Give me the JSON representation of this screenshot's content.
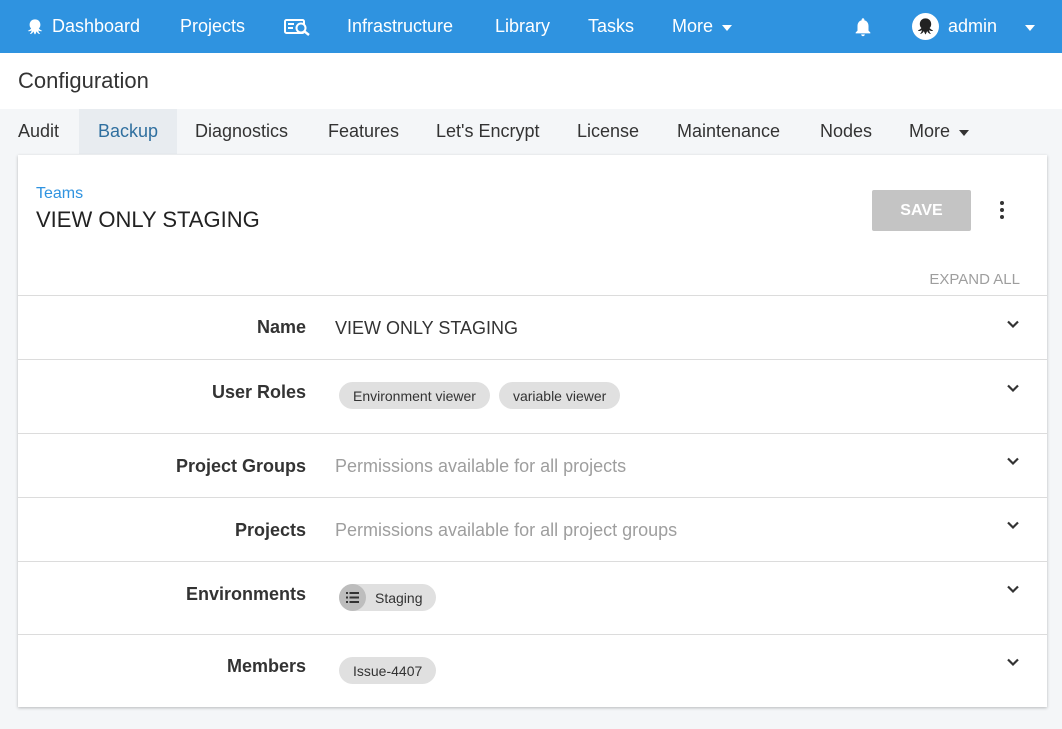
{
  "topbar": {
    "items": [
      {
        "label": "Dashboard"
      },
      {
        "label": "Projects"
      },
      {
        "label": "Infrastructure"
      },
      {
        "label": "Library"
      },
      {
        "label": "Tasks"
      },
      {
        "label": "More"
      }
    ],
    "user": "admin",
    "color": "#2f93e0",
    "icons": [
      "octopus-icon",
      "search-report-icon",
      "bell-icon",
      "avatar-icon",
      "chevron-down-icon"
    ]
  },
  "page": {
    "title": "Configuration"
  },
  "tabs": {
    "items": [
      {
        "label": "Audit"
      },
      {
        "label": "Backup"
      },
      {
        "label": "Diagnostics"
      },
      {
        "label": "Features"
      },
      {
        "label": "Let's Encrypt"
      },
      {
        "label": "License"
      },
      {
        "label": "Maintenance"
      },
      {
        "label": "Nodes"
      },
      {
        "label": "More"
      }
    ],
    "active": "Backup"
  },
  "card": {
    "breadcrumb": "Teams",
    "title": "VIEW ONLY STAGING",
    "save_label": "SAVE",
    "expand_all": "EXPAND ALL",
    "rows": [
      {
        "label": "Name",
        "value": "VIEW ONLY STAGING"
      },
      {
        "label": "User Roles",
        "chips": [
          "Environment viewer",
          "variable viewer"
        ]
      },
      {
        "label": "Project Groups",
        "value": "Permissions available for all projects"
      },
      {
        "label": "Projects",
        "value": "Permissions available for all project groups"
      },
      {
        "label": "Environments",
        "chips": [
          "Staging"
        ]
      },
      {
        "label": "Members",
        "chips": [
          "Issue-4407"
        ]
      }
    ]
  }
}
